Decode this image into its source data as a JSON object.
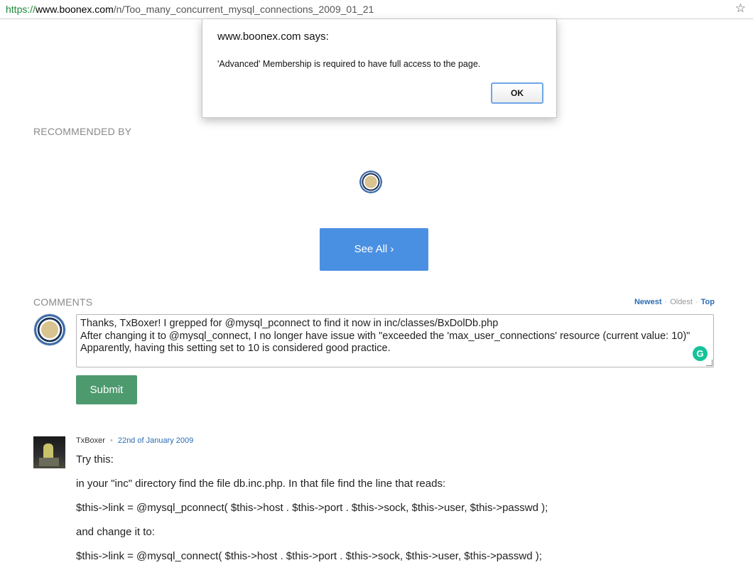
{
  "browser": {
    "url_scheme": "https://",
    "url_host": "www.boonex.com",
    "url_path": "/n/Too_many_concurrent_mysql_connections_2009_01_21",
    "bookmark_icon": "star-icon"
  },
  "recommended": {
    "heading": "RECOMMENDED BY",
    "see_all_label": "See All ›"
  },
  "comments": {
    "heading": "COMMENTS",
    "sort": {
      "newest": "Newest",
      "oldest": "Oldest",
      "top": "Top",
      "separator": "·"
    },
    "draft_lines": [
      "Thanks, TxBoxer! I grepped for @mysql_pconnect to find it now in inc/classes/BxDolDb.php",
      "After changing it to @mysql_connect, I no longer have issue with \"exceeded the 'max_user_connections' resource (current value: 10)\"",
      "Apparently, having this setting set to 10 is considered good practice."
    ],
    "submit_label": "Submit",
    "items": [
      {
        "author": "TxBoxer",
        "separator": "•",
        "date": "22nd of January 2009",
        "lines": [
          "Try this:",
          "in your \"inc\" directory find the file db.inc.php. In that file find the line that reads:",
          "$this->link = @mysql_pconnect( $this->host . $this->port . $this->sock, $this->user, $this->passwd );",
          "and change it to:",
          "$this->link = @mysql_connect( $this->host . $this->port . $this->sock, $this->user, $this->passwd );"
        ]
      }
    ]
  },
  "dialog": {
    "title": "www.boonex.com says:",
    "message": "'Advanced' Membership is required to have full access to the page.",
    "ok_label": "OK"
  },
  "colors": {
    "see_all_bg": "#4a90e2",
    "submit_bg": "#4e9a6f",
    "link_blue": "#2a6db5"
  }
}
